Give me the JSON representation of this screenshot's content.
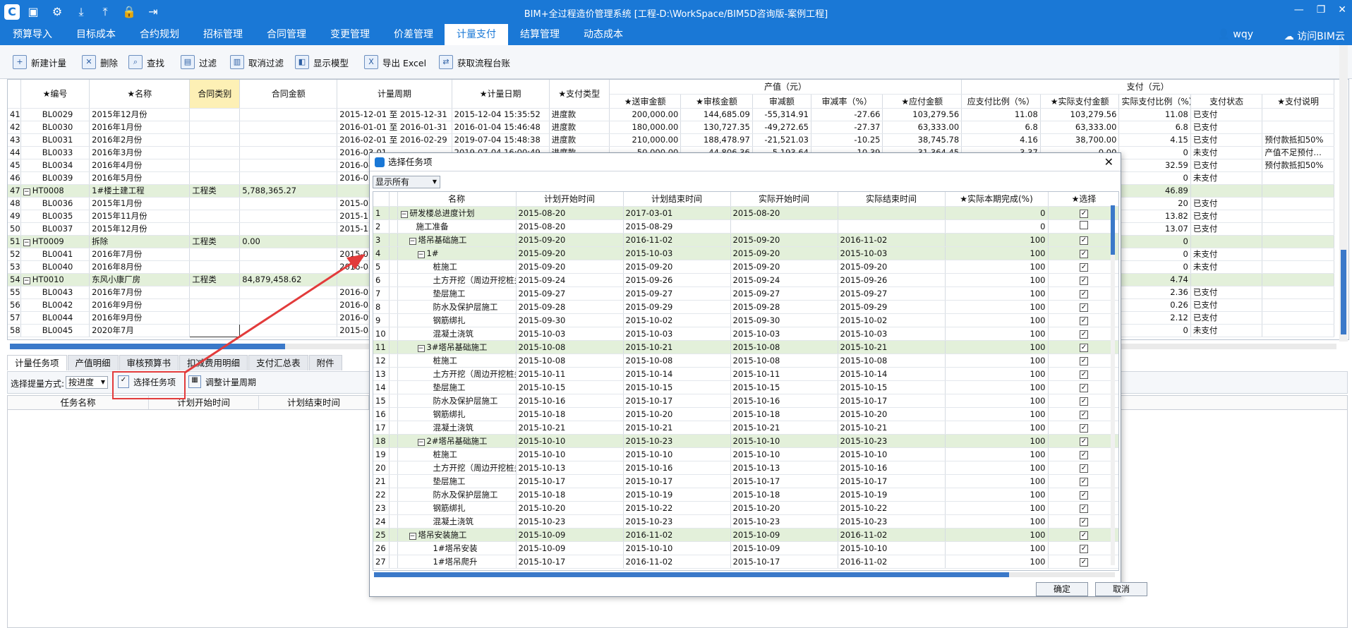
{
  "app": {
    "title": "BIM+全过程造价管理系统 [工程-D:\\WorkSpace/BIM5D咨询版-案例工程]",
    "user": "wqy",
    "cloud": "访问BIM云"
  },
  "menu": [
    "预算导入",
    "目标成本",
    "合约规划",
    "招标管理",
    "合同管理",
    "变更管理",
    "价差管理",
    "计量支付",
    "结算管理",
    "动态成本"
  ],
  "toolbar": [
    "新建计量",
    "删除",
    "查找",
    "过滤",
    "取消过滤",
    "显示模型",
    "导出 Excel",
    "获取流程台账"
  ],
  "grid": {
    "group_headers": {
      "output": "产值（元）",
      "payment": "支付（元）"
    },
    "headers": [
      "★编号",
      "★名称",
      "合同类别",
      "合同金额",
      "计量周期",
      "★计量日期",
      "★支付类型",
      "★送审金额",
      "★审核金额",
      "审减额",
      "审减率（%）",
      "★应付金额",
      "应支付比例（%）",
      "★实际支付金额",
      "实际支付比例（%）",
      "支付状态",
      "★支付说明"
    ],
    "rows": [
      {
        "n": "41",
        "c": [
          "BL0029",
          "2015年12月份",
          "",
          "",
          "2015-12-01 至 2015-12-31",
          "2015-12-04 15:35:52",
          "进度款",
          "200,000.00",
          "144,685.09",
          "-55,314.91",
          "-27.66",
          "103,279.56",
          "11.08",
          "103,279.56",
          "11.08",
          "已支付",
          ""
        ]
      },
      {
        "n": "42",
        "c": [
          "BL0030",
          "2016年1月份",
          "",
          "",
          "2016-01-01 至 2016-01-31",
          "2016-01-04 15:46:48",
          "进度款",
          "180,000.00",
          "130,727.35",
          "-49,272.65",
          "-27.37",
          "63,333.00",
          "6.8",
          "63,333.00",
          "6.8",
          "已支付",
          ""
        ]
      },
      {
        "n": "43",
        "c": [
          "BL0031",
          "2016年2月份",
          "",
          "",
          "2016-02-01 至 2016-02-29",
          "2019-07-04 15:48:38",
          "进度款",
          "210,000.00",
          "188,478.97",
          "-21,521.03",
          "-10.25",
          "38,745.78",
          "4.16",
          "38,700.00",
          "4.15",
          "已支付",
          "预付款抵扣50%"
        ]
      },
      {
        "n": "44",
        "c": [
          "BL0033",
          "2016年3月份",
          "",
          "",
          "2016-03-01",
          "2019-07-04 16:00:49",
          "进度款",
          "50,000.00",
          "44,806.36",
          "-5,193.64",
          "-10.39",
          "31,364.45",
          "3.37",
          "0.00",
          "0",
          "未支付",
          "产值不足预付…"
        ]
      },
      {
        "n": "45",
        "c": [
          "BL0034",
          "2016年4月份",
          "",
          "",
          "2016-04-0",
          "",
          "",
          "",
          "",
          "",
          "",
          "",
          "",
          "",
          "32.59",
          "已支付",
          "预付款抵扣50%"
        ]
      },
      {
        "n": "46",
        "c": [
          "BL0039",
          "2016年5月份",
          "",
          "",
          "2016-05-0",
          "",
          "",
          "",
          "",
          "",
          "",
          "",
          "",
          "",
          "0",
          "未支付",
          ""
        ]
      },
      {
        "n": "47",
        "g": 1,
        "c": [
          "HT0008",
          "1#楼土建工程",
          "工程类",
          "5,788,365.27",
          "",
          "",
          "",
          "",
          "",
          "",
          "",
          "",
          "",
          "",
          "46.89",
          "",
          ""
        ]
      },
      {
        "n": "48",
        "c": [
          "BL0036",
          "2015年1月份",
          "",
          "",
          "2015-01-0",
          "",
          "",
          "",
          "",
          "",
          "",
          "",
          "",
          "",
          "20",
          "已支付",
          ""
        ]
      },
      {
        "n": "49",
        "c": [
          "BL0035",
          "2015年11月份",
          "",
          "",
          "2015-11-0",
          "",
          "",
          "",
          "",
          "",
          "",
          "",
          "",
          "",
          "13.82",
          "已支付",
          ""
        ]
      },
      {
        "n": "50",
        "c": [
          "BL0037",
          "2015年12月份",
          "",
          "",
          "2015-12-0",
          "",
          "",
          "",
          "",
          "",
          "",
          "",
          "",
          "",
          "13.07",
          "已支付",
          ""
        ]
      },
      {
        "n": "51",
        "g": 1,
        "c": [
          "HT0009",
          "拆除",
          "工程类",
          "0.00",
          "",
          "",
          "",
          "",
          "",
          "",
          "",
          "",
          "",
          "",
          "0",
          "",
          ""
        ]
      },
      {
        "n": "52",
        "c": [
          "BL0041",
          "2016年7月份",
          "",
          "",
          "2015-07-0",
          "",
          "",
          "",
          "",
          "",
          "",
          "",
          "",
          "",
          "0",
          "未支付",
          ""
        ]
      },
      {
        "n": "53",
        "c": [
          "BL0040",
          "2016年8月份",
          "",
          "",
          "2016-08-0",
          "",
          "",
          "",
          "",
          "",
          "",
          "",
          "",
          "",
          "0",
          "未支付",
          ""
        ]
      },
      {
        "n": "54",
        "g": 1,
        "c": [
          "HT0010",
          "东风小康厂房",
          "工程类",
          "84,879,458.62",
          "",
          "",
          "",
          "",
          "",
          "",
          "",
          "",
          "",
          "",
          "4.74",
          "",
          ""
        ]
      },
      {
        "n": "55",
        "c": [
          "BL0043",
          "2016年7月份",
          "",
          "",
          "2016-07-0",
          "",
          "",
          "",
          "",
          "",
          "",
          "",
          "",
          "",
          "2.36",
          "已支付",
          ""
        ]
      },
      {
        "n": "56",
        "c": [
          "BL0042",
          "2016年9月份",
          "",
          "",
          "2016-08-0",
          "",
          "",
          "",
          "",
          "",
          "",
          "",
          "",
          "",
          "0.26",
          "已支付",
          ""
        ]
      },
      {
        "n": "57",
        "c": [
          "BL0044",
          "2016年9月份",
          "",
          "",
          "2016-09-0",
          "",
          "",
          "",
          "",
          "",
          "",
          "",
          "",
          "",
          "2.12",
          "已支付",
          ""
        ]
      },
      {
        "n": "58",
        "c": [
          "BL0045",
          "2020年7月",
          "",
          "",
          "2015-08-2",
          "",
          "",
          "",
          "",
          "",
          "",
          "",
          "",
          "",
          "0",
          "未支付",
          ""
        ]
      }
    ]
  },
  "bottom_tabs": [
    "计量任务项",
    "产值明细",
    "审核预算书",
    "扣减费用明细",
    "支付汇总表",
    "附件"
  ],
  "subbar": {
    "mode_label": "选择提量方式:",
    "mode_value": "按进度",
    "select_btn": "选择任务项",
    "adjust_btn": "调整计量周期"
  },
  "subgrid_headers": [
    "任务名称",
    "计划开始时间",
    "计划结束时间"
  ],
  "dialog": {
    "title": "选择任务项",
    "filter": "显示所有",
    "headers": [
      "名称",
      "计划开始时间",
      "计划结束时间",
      "实际开始时间",
      "实际结束时间",
      "★实际本期完成(%)",
      "★选择"
    ],
    "rows": [
      {
        "n": "1",
        "lvl": 0,
        "g": 1,
        "exp": "−",
        "c": [
          "研发楼总进度计划",
          "2015-08-20",
          "2017-03-01",
          "2015-08-20",
          "",
          "0"
        ],
        "chk": true
      },
      {
        "n": "2",
        "lvl": 1,
        "c": [
          "施工准备",
          "2015-08-20",
          "2015-08-29",
          "",
          "",
          "0"
        ],
        "chk": false
      },
      {
        "n": "3",
        "lvl": 1,
        "g": 1,
        "exp": "−",
        "c": [
          "塔吊基础施工",
          "2015-09-20",
          "2016-11-02",
          "2015-09-20",
          "2016-11-02",
          "100"
        ],
        "chk": true
      },
      {
        "n": "4",
        "lvl": 2,
        "g": 1,
        "exp": "−",
        "c": [
          "1#",
          "2015-09-20",
          "2015-10-03",
          "2015-09-20",
          "2015-10-03",
          "100"
        ],
        "chk": true
      },
      {
        "n": "5",
        "lvl": 3,
        "c": [
          "桩施工",
          "2015-09-20",
          "2015-09-20",
          "2015-09-20",
          "2015-09-20",
          "100"
        ],
        "chk": true
      },
      {
        "n": "6",
        "lvl": 3,
        "c": [
          "土方开挖（周边开挖桩头…",
          "2015-09-24",
          "2015-09-26",
          "2015-09-24",
          "2015-09-26",
          "100"
        ],
        "chk": true
      },
      {
        "n": "7",
        "lvl": 3,
        "c": [
          "垫层施工",
          "2015-09-27",
          "2015-09-27",
          "2015-09-27",
          "2015-09-27",
          "100"
        ],
        "chk": true
      },
      {
        "n": "8",
        "lvl": 3,
        "c": [
          "防水及保护层施工",
          "2015-09-28",
          "2015-09-29",
          "2015-09-28",
          "2015-09-29",
          "100"
        ],
        "chk": true
      },
      {
        "n": "9",
        "lvl": 3,
        "c": [
          "钢筋绑扎",
          "2015-09-30",
          "2015-10-02",
          "2015-09-30",
          "2015-10-02",
          "100"
        ],
        "chk": true
      },
      {
        "n": "10",
        "lvl": 3,
        "c": [
          "混凝土浇筑",
          "2015-10-03",
          "2015-10-03",
          "2015-10-03",
          "2015-10-03",
          "100"
        ],
        "chk": true
      },
      {
        "n": "11",
        "lvl": 2,
        "g": 1,
        "exp": "−",
        "c": [
          "3#塔吊基础施工",
          "2015-10-08",
          "2015-10-21",
          "2015-10-08",
          "2015-10-21",
          "100"
        ],
        "chk": true
      },
      {
        "n": "12",
        "lvl": 3,
        "c": [
          "桩施工",
          "2015-10-08",
          "2015-10-08",
          "2015-10-08",
          "2015-10-08",
          "100"
        ],
        "chk": true
      },
      {
        "n": "13",
        "lvl": 3,
        "c": [
          "土方开挖（周边开挖桩头…",
          "2015-10-11",
          "2015-10-14",
          "2015-10-11",
          "2015-10-14",
          "100"
        ],
        "chk": true
      },
      {
        "n": "14",
        "lvl": 3,
        "c": [
          "垫层施工",
          "2015-10-15",
          "2015-10-15",
          "2015-10-15",
          "2015-10-15",
          "100"
        ],
        "chk": true
      },
      {
        "n": "15",
        "lvl": 3,
        "c": [
          "防水及保护层施工",
          "2015-10-16",
          "2015-10-17",
          "2015-10-16",
          "2015-10-17",
          "100"
        ],
        "chk": true
      },
      {
        "n": "16",
        "lvl": 3,
        "c": [
          "钢筋绑扎",
          "2015-10-18",
          "2015-10-20",
          "2015-10-18",
          "2015-10-20",
          "100"
        ],
        "chk": true
      },
      {
        "n": "17",
        "lvl": 3,
        "c": [
          "混凝土浇筑",
          "2015-10-21",
          "2015-10-21",
          "2015-10-21",
          "2015-10-21",
          "100"
        ],
        "chk": true
      },
      {
        "n": "18",
        "lvl": 2,
        "g": 1,
        "exp": "−",
        "c": [
          "2#塔吊基础施工",
          "2015-10-10",
          "2015-10-23",
          "2015-10-10",
          "2015-10-23",
          "100"
        ],
        "chk": true
      },
      {
        "n": "19",
        "lvl": 3,
        "c": [
          "桩施工",
          "2015-10-10",
          "2015-10-10",
          "2015-10-10",
          "2015-10-10",
          "100"
        ],
        "chk": true
      },
      {
        "n": "20",
        "lvl": 3,
        "c": [
          "土方开挖（周边开挖桩头…",
          "2015-10-13",
          "2015-10-16",
          "2015-10-13",
          "2015-10-16",
          "100"
        ],
        "chk": true
      },
      {
        "n": "21",
        "lvl": 3,
        "c": [
          "垫层施工",
          "2015-10-17",
          "2015-10-17",
          "2015-10-17",
          "2015-10-17",
          "100"
        ],
        "chk": true
      },
      {
        "n": "22",
        "lvl": 3,
        "c": [
          "防水及保护层施工",
          "2015-10-18",
          "2015-10-19",
          "2015-10-18",
          "2015-10-19",
          "100"
        ],
        "chk": true
      },
      {
        "n": "23",
        "lvl": 3,
        "c": [
          "钢筋绑扎",
          "2015-10-20",
          "2015-10-22",
          "2015-10-20",
          "2015-10-22",
          "100"
        ],
        "chk": true
      },
      {
        "n": "24",
        "lvl": 3,
        "c": [
          "混凝土浇筑",
          "2015-10-23",
          "2015-10-23",
          "2015-10-23",
          "2015-10-23",
          "100"
        ],
        "chk": true
      },
      {
        "n": "25",
        "lvl": 1,
        "g": 1,
        "exp": "−",
        "c": [
          "塔吊安装施工",
          "2015-10-09",
          "2016-11-02",
          "2015-10-09",
          "2016-11-02",
          "100"
        ],
        "chk": true
      },
      {
        "n": "26",
        "lvl": 3,
        "c": [
          "1#塔吊安装",
          "2015-10-09",
          "2015-10-10",
          "2015-10-09",
          "2015-10-10",
          "100"
        ],
        "chk": true
      },
      {
        "n": "27",
        "lvl": 3,
        "c": [
          "1#塔吊爬升",
          "2015-10-17",
          "2016-11-02",
          "2015-10-17",
          "2016-11-02",
          "100"
        ],
        "chk": true
      }
    ],
    "ok": "确定",
    "cancel": "取消"
  }
}
